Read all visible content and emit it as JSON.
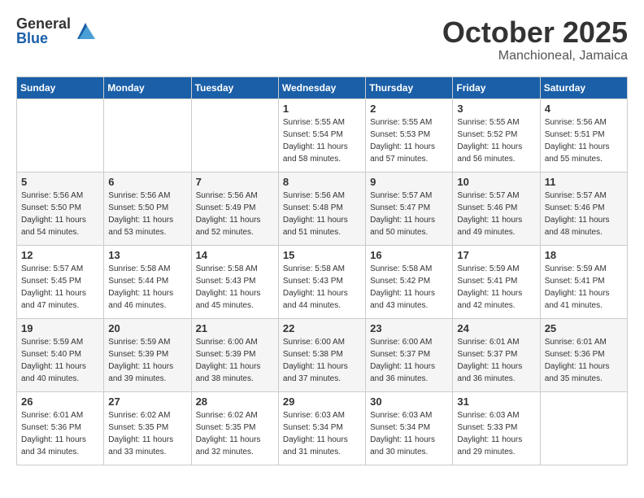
{
  "logo": {
    "general": "General",
    "blue": "Blue"
  },
  "title": "October 2025",
  "location": "Manchioneal, Jamaica",
  "days_of_week": [
    "Sunday",
    "Monday",
    "Tuesday",
    "Wednesday",
    "Thursday",
    "Friday",
    "Saturday"
  ],
  "weeks": [
    [
      {
        "day": "",
        "info": ""
      },
      {
        "day": "",
        "info": ""
      },
      {
        "day": "",
        "info": ""
      },
      {
        "day": "1",
        "info": "Sunrise: 5:55 AM\nSunset: 5:54 PM\nDaylight: 11 hours\nand 58 minutes."
      },
      {
        "day": "2",
        "info": "Sunrise: 5:55 AM\nSunset: 5:53 PM\nDaylight: 11 hours\nand 57 minutes."
      },
      {
        "day": "3",
        "info": "Sunrise: 5:55 AM\nSunset: 5:52 PM\nDaylight: 11 hours\nand 56 minutes."
      },
      {
        "day": "4",
        "info": "Sunrise: 5:56 AM\nSunset: 5:51 PM\nDaylight: 11 hours\nand 55 minutes."
      }
    ],
    [
      {
        "day": "5",
        "info": "Sunrise: 5:56 AM\nSunset: 5:50 PM\nDaylight: 11 hours\nand 54 minutes."
      },
      {
        "day": "6",
        "info": "Sunrise: 5:56 AM\nSunset: 5:50 PM\nDaylight: 11 hours\nand 53 minutes."
      },
      {
        "day": "7",
        "info": "Sunrise: 5:56 AM\nSunset: 5:49 PM\nDaylight: 11 hours\nand 52 minutes."
      },
      {
        "day": "8",
        "info": "Sunrise: 5:56 AM\nSunset: 5:48 PM\nDaylight: 11 hours\nand 51 minutes."
      },
      {
        "day": "9",
        "info": "Sunrise: 5:57 AM\nSunset: 5:47 PM\nDaylight: 11 hours\nand 50 minutes."
      },
      {
        "day": "10",
        "info": "Sunrise: 5:57 AM\nSunset: 5:46 PM\nDaylight: 11 hours\nand 49 minutes."
      },
      {
        "day": "11",
        "info": "Sunrise: 5:57 AM\nSunset: 5:46 PM\nDaylight: 11 hours\nand 48 minutes."
      }
    ],
    [
      {
        "day": "12",
        "info": "Sunrise: 5:57 AM\nSunset: 5:45 PM\nDaylight: 11 hours\nand 47 minutes."
      },
      {
        "day": "13",
        "info": "Sunrise: 5:58 AM\nSunset: 5:44 PM\nDaylight: 11 hours\nand 46 minutes."
      },
      {
        "day": "14",
        "info": "Sunrise: 5:58 AM\nSunset: 5:43 PM\nDaylight: 11 hours\nand 45 minutes."
      },
      {
        "day": "15",
        "info": "Sunrise: 5:58 AM\nSunset: 5:43 PM\nDaylight: 11 hours\nand 44 minutes."
      },
      {
        "day": "16",
        "info": "Sunrise: 5:58 AM\nSunset: 5:42 PM\nDaylight: 11 hours\nand 43 minutes."
      },
      {
        "day": "17",
        "info": "Sunrise: 5:59 AM\nSunset: 5:41 PM\nDaylight: 11 hours\nand 42 minutes."
      },
      {
        "day": "18",
        "info": "Sunrise: 5:59 AM\nSunset: 5:41 PM\nDaylight: 11 hours\nand 41 minutes."
      }
    ],
    [
      {
        "day": "19",
        "info": "Sunrise: 5:59 AM\nSunset: 5:40 PM\nDaylight: 11 hours\nand 40 minutes."
      },
      {
        "day": "20",
        "info": "Sunrise: 5:59 AM\nSunset: 5:39 PM\nDaylight: 11 hours\nand 39 minutes."
      },
      {
        "day": "21",
        "info": "Sunrise: 6:00 AM\nSunset: 5:39 PM\nDaylight: 11 hours\nand 38 minutes."
      },
      {
        "day": "22",
        "info": "Sunrise: 6:00 AM\nSunset: 5:38 PM\nDaylight: 11 hours\nand 37 minutes."
      },
      {
        "day": "23",
        "info": "Sunrise: 6:00 AM\nSunset: 5:37 PM\nDaylight: 11 hours\nand 36 minutes."
      },
      {
        "day": "24",
        "info": "Sunrise: 6:01 AM\nSunset: 5:37 PM\nDaylight: 11 hours\nand 36 minutes."
      },
      {
        "day": "25",
        "info": "Sunrise: 6:01 AM\nSunset: 5:36 PM\nDaylight: 11 hours\nand 35 minutes."
      }
    ],
    [
      {
        "day": "26",
        "info": "Sunrise: 6:01 AM\nSunset: 5:36 PM\nDaylight: 11 hours\nand 34 minutes."
      },
      {
        "day": "27",
        "info": "Sunrise: 6:02 AM\nSunset: 5:35 PM\nDaylight: 11 hours\nand 33 minutes."
      },
      {
        "day": "28",
        "info": "Sunrise: 6:02 AM\nSunset: 5:35 PM\nDaylight: 11 hours\nand 32 minutes."
      },
      {
        "day": "29",
        "info": "Sunrise: 6:03 AM\nSunset: 5:34 PM\nDaylight: 11 hours\nand 31 minutes."
      },
      {
        "day": "30",
        "info": "Sunrise: 6:03 AM\nSunset: 5:34 PM\nDaylight: 11 hours\nand 30 minutes."
      },
      {
        "day": "31",
        "info": "Sunrise: 6:03 AM\nSunset: 5:33 PM\nDaylight: 11 hours\nand 29 minutes."
      },
      {
        "day": "",
        "info": ""
      }
    ]
  ]
}
